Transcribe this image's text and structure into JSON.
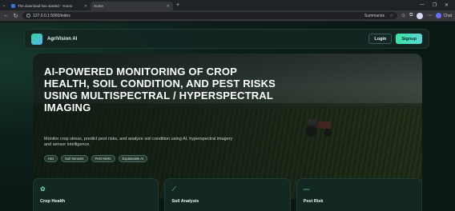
{
  "browser": {
    "tabs": [
      {
        "title": "The download has started - Yoursi",
        "active": false
      },
      {
        "title": "Home",
        "active": true
      }
    ],
    "new_tab": "+",
    "url": "127.0.0.1:5000/index",
    "summarize_label": "Summarize",
    "chat_label": "Chat"
  },
  "navbar": {
    "brand": "AgriVision AI",
    "login": "Login",
    "signup": "Signup"
  },
  "hero": {
    "title": "AI-POWERED MONITORING OF CROP HEALTH, SOIL CONDITION, AND PEST RISKS USING MULTISPECTRAL / HYPERSPECTRAL IMAGING",
    "description": "Monitor crop stress, predict pest risks, and analyze soil condition using AI, hyperspectral imagery and sensor intelligence.",
    "tags": [
      "HSI",
      "Soil Sensors",
      "Pest Alerts",
      "Explainable AI"
    ]
  },
  "cards": [
    {
      "title": "Crop Health",
      "icon": "seedling-icon",
      "glyph": "✿"
    },
    {
      "title": "Soil Analysis",
      "icon": "shovel-icon",
      "glyph": "⟋"
    },
    {
      "title": "Pest Risk",
      "icon": "bug-icon",
      "glyph": "〰"
    }
  ],
  "colors": {
    "accent": "#3be3a5",
    "page_bg": "#0b1613",
    "card_bg": "#132823"
  }
}
